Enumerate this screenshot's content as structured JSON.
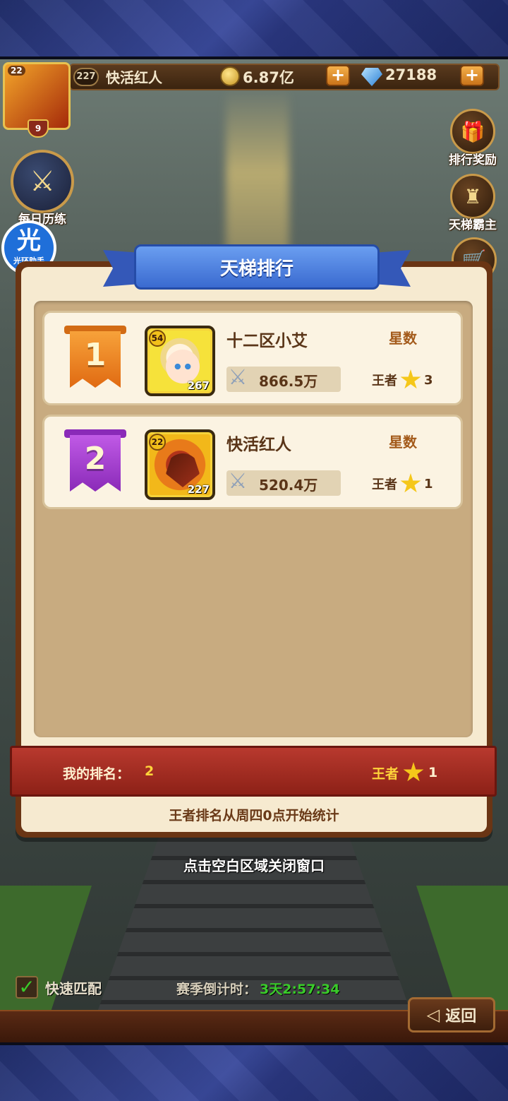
{
  "header": {
    "player_level": "22",
    "player_rank_badge": "9",
    "player_power": "227",
    "player_name": "快活红人",
    "gold": "6.87亿",
    "gems": "27188",
    "plus_label": "+"
  },
  "side_buttons": {
    "daily_training": "每日历练",
    "rank_rewards": "排行奖励",
    "ladder_champion": "天梯霸主"
  },
  "assistant": {
    "glyph": "光",
    "label": "光环助手"
  },
  "panel": {
    "title": "天梯排行",
    "stars_header": "星数",
    "rows": [
      {
        "rank": "1",
        "hero_level": "54",
        "hero_power": "267",
        "name": "十二区小艾",
        "power": "866.5万",
        "tier": "王者",
        "stars": "3"
      },
      {
        "rank": "2",
        "hero_level": "22",
        "hero_power": "227",
        "name": "快活红人",
        "power": "520.4万",
        "tier": "王者",
        "stars": "1"
      }
    ],
    "my_rank_label": "我的排名：",
    "my_rank_value": "2",
    "my_tier": "王者",
    "my_stars": "1",
    "footer_note": "王者排名从周四0点开始统计"
  },
  "close_hint": "点击空白区域关闭窗口",
  "bottom": {
    "quick_match": "快速匹配",
    "season_label": "赛季倒计时：",
    "season_countdown": "3天2:57:34",
    "back": "返回"
  },
  "colors": {
    "gold_medal": "#e06a12",
    "purple_medal": "#8a2ab8",
    "ribbon_blue": "#3a6ad0",
    "my_rank_red": "#b8392e",
    "countdown_green": "#3acb2a"
  }
}
